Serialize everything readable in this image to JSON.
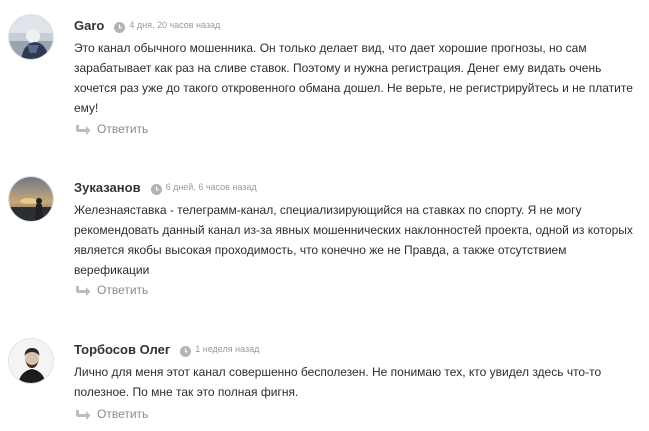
{
  "comments": [
    {
      "author": "Garo",
      "date": "4 дня, 20 часов назад",
      "lines": [
        "Это канал обычного мошенника. Он только делает вид, что дает хорошие прогнозы, но сам",
        "зарабатывает как раз на сливе ставок. Поэтому и нужна регистрация. Денег ему видать очень",
        "хочется раз уже до такого откровенного обмана дошел. Не верьте, не регистрируйтесь и не платите",
        "ему!"
      ],
      "reply_label": "Ответить"
    },
    {
      "author": "Зуказанов",
      "date": "6 дней, 6 часов назад",
      "lines": [
        "Железнаяставка - телеграмм-канал, специализирующийся на ставках по спорту. Я не могу",
        "рекомендовать данный канал из-за явных мошеннических наклонностей проекта, одной из которых",
        "является якобы высокая проходимость, что конечно же не Правда, а также отсутствием",
        "верефикации"
      ],
      "reply_label": "Ответить"
    },
    {
      "author": "Торбосов Олег",
      "date": "1 неделя назад",
      "lines": [
        "Лично для меня этот канал совершенно бесполезен. Не понимаю тех, кто увидел здесь что-то",
        "полезное. По мне так это полная фигня."
      ],
      "reply_label": "Ответить"
    }
  ],
  "icons": {
    "clock": "clock-icon",
    "reply": "reply-arrow-icon"
  },
  "colors": {
    "author": "#333333",
    "meta": "#9a9a9a",
    "reply": "#8a8a8a",
    "text": "#2d2d2d"
  }
}
